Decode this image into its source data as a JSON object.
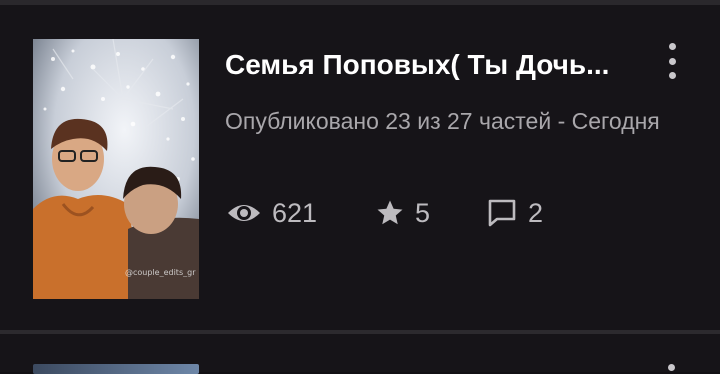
{
  "fanfic": {
    "title": "Семья Поповых( Ты Дочь...",
    "meta": "Опубликовано 23 из 27 частей - Сегодня",
    "cover_caption": "@couple_edits_gr",
    "stats": {
      "views": "621",
      "stars": "5",
      "comments": "2"
    }
  },
  "icons": {
    "views": "eye-icon",
    "stars": "star-icon",
    "comments": "comment-icon",
    "menu": "more-vertical-icon"
  },
  "colors": {
    "background": "#121014",
    "card": "#161418",
    "title": "#ffffff",
    "meta": "#a9a7ab",
    "stat": "#bdbbbf"
  }
}
